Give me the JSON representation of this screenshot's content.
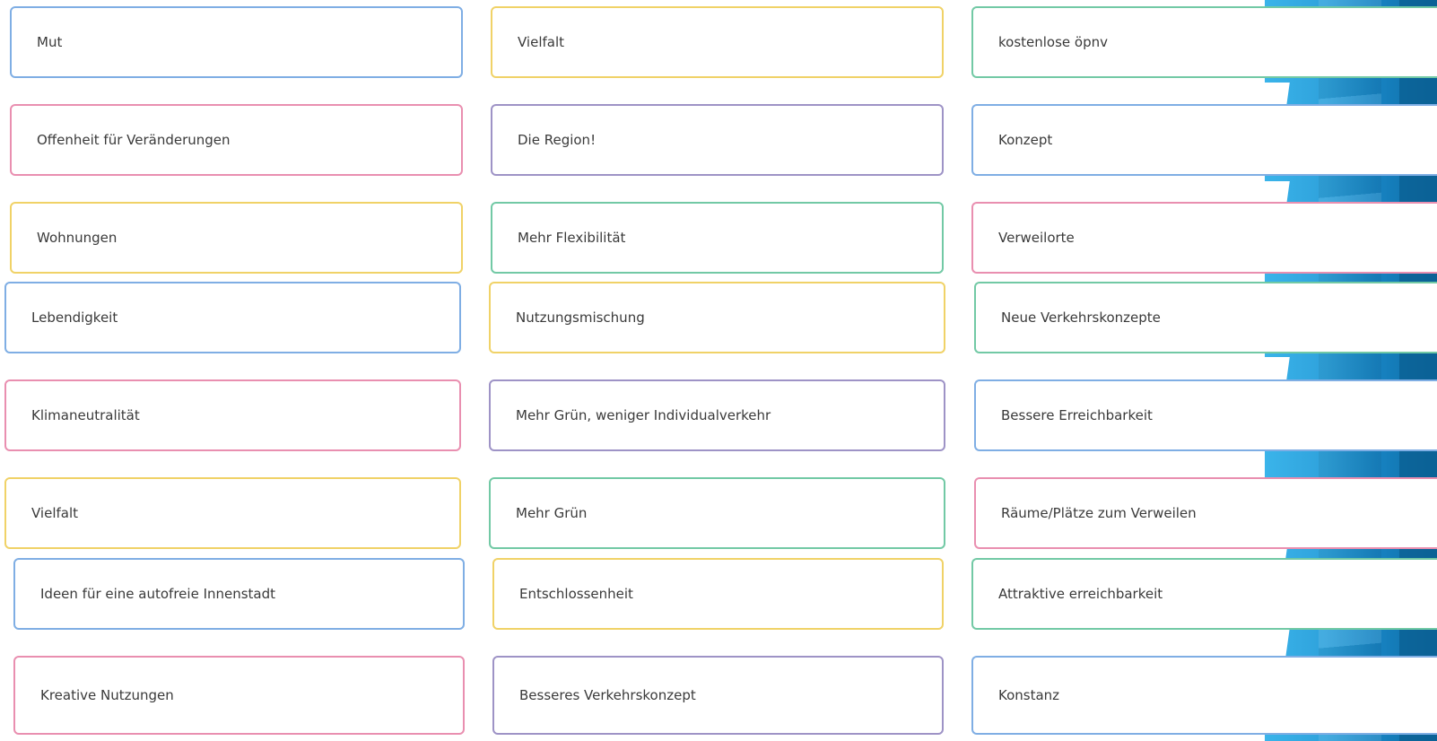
{
  "colors": {
    "blue": "#7faee4",
    "pink": "#e98fb0",
    "yellow": "#f0d267",
    "purple": "#9e93c6",
    "green": "#72c9a5"
  },
  "cards": [
    {
      "label": "Mut",
      "color": "blue"
    },
    {
      "label": "Vielfalt",
      "color": "yellow"
    },
    {
      "label": "kostenlose öpnv",
      "color": "green"
    },
    {
      "label": "Offenheit für Veränderungen",
      "color": "pink"
    },
    {
      "label": "Die Region!",
      "color": "purple"
    },
    {
      "label": "Konzept",
      "color": "blue"
    },
    {
      "label": "Wohnungen",
      "color": "yellow"
    },
    {
      "label": "Mehr Flexibilität",
      "color": "green"
    },
    {
      "label": "Verweilorte",
      "color": "pink"
    },
    {
      "label": "Lebendigkeit",
      "color": "blue"
    },
    {
      "label": "Nutzungsmischung",
      "color": "yellow"
    },
    {
      "label": "Neue Verkehrskonzepte",
      "color": "green"
    },
    {
      "label": "Klimaneutralität",
      "color": "pink"
    },
    {
      "label": "Mehr Grün, weniger Individualverkehr",
      "color": "purple"
    },
    {
      "label": "Bessere Erreichbarkeit",
      "color": "blue"
    },
    {
      "label": "Vielfalt",
      "color": "yellow"
    },
    {
      "label": "Mehr Grün",
      "color": "green"
    },
    {
      "label": "Räume/Plätze zum Verweilen",
      "color": "pink"
    },
    {
      "label": "Ideen für eine autofreie Innenstadt",
      "color": "blue"
    },
    {
      "label": "Entschlossenheit",
      "color": "yellow"
    },
    {
      "label": "Attraktive erreichbarkeit",
      "color": "green"
    },
    {
      "label": "Kreative Nutzungen",
      "color": "pink"
    },
    {
      "label": "Besseres Verkehrskonzept",
      "color": "purple"
    },
    {
      "label": "Konstanz",
      "color": "blue"
    }
  ]
}
